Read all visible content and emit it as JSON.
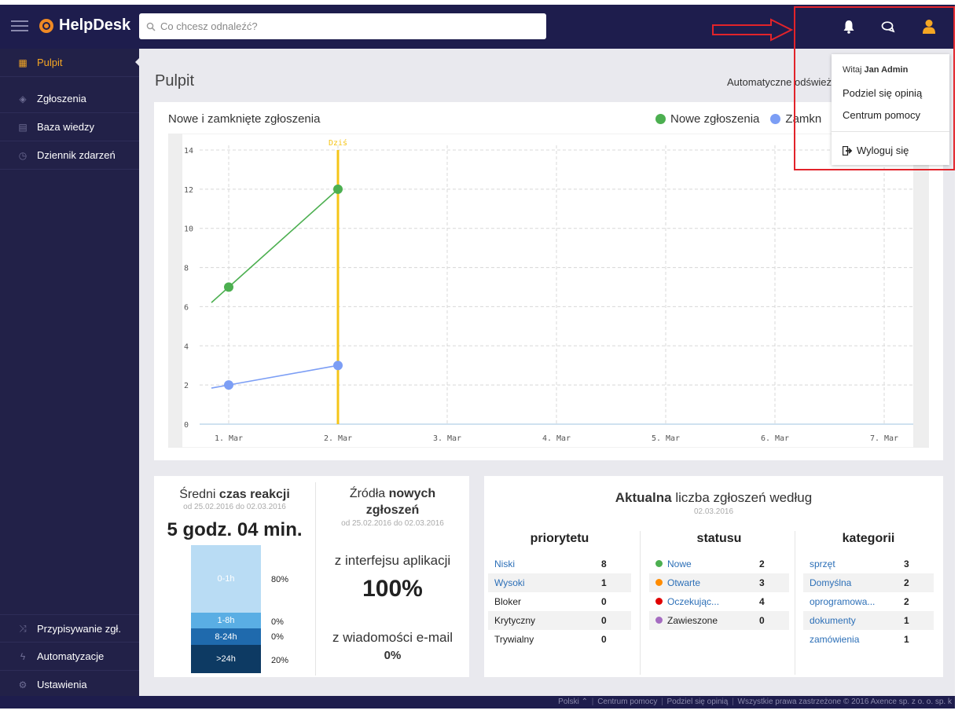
{
  "app": {
    "logo": "HelpDesk"
  },
  "search": {
    "placeholder": "Co chcesz odnaleźć?"
  },
  "sidebar": {
    "items": [
      {
        "label": "Pulpit"
      },
      {
        "label": "Zgłoszenia"
      },
      {
        "label": "Baza wiedzy"
      },
      {
        "label": "Dziennik zdarzeń"
      }
    ],
    "bottom": [
      {
        "label": "Przypisywanie zgł."
      },
      {
        "label": "Automatyzacje"
      },
      {
        "label": "Ustawienia"
      }
    ]
  },
  "page": {
    "title": "Pulpit",
    "auto_refresh": "Automatyczne odśwież"
  },
  "user_menu": {
    "welcome_prefix": "Witaj",
    "user_name": "Jan Admin",
    "items": [
      "Podziel się opinią",
      "Centrum pomocy"
    ],
    "logout": "Wyloguj się"
  },
  "chart_data": {
    "type": "line",
    "title": "Nowe i zamknięte zgłoszenia",
    "x": [
      "1. Mar",
      "2. Mar",
      "3. Mar",
      "4. Mar",
      "5. Mar",
      "6. Mar",
      "7. Mar"
    ],
    "series": [
      {
        "name": "Nowe zgłoszenia",
        "color": "#4caf50",
        "values": [
          7,
          12
        ]
      },
      {
        "name": "Zamkn",
        "color": "#7c9ef5",
        "values": [
          2,
          3
        ]
      }
    ],
    "ylim": [
      0,
      14
    ],
    "yticks": [
      0,
      2,
      4,
      6,
      8,
      10,
      12,
      14
    ],
    "today_label": "Dziś",
    "today_index": 1,
    "today_color": "#f5c518",
    "grid": true,
    "legend": "top-right"
  },
  "response": {
    "title_plain": "Średni",
    "title_bold": "czas reakcji",
    "range": "od 25.02.2016 do 02.03.2016",
    "value": "5 godz. 04 min.",
    "buckets": [
      {
        "label": "0-1h",
        "pct": "80%",
        "share": 0.8,
        "color": "#b9dcf4"
      },
      {
        "label": "1-8h",
        "pct": "0%",
        "share": 0.0,
        "color": "#5aaee4"
      },
      {
        "label": "8-24h",
        "pct": "0%",
        "share": 0.0,
        "color": "#1f6aad"
      },
      {
        "label": ">24h",
        "pct": "20%",
        "share": 0.2,
        "color": "#0d3a63"
      }
    ]
  },
  "sources": {
    "title_plain": "Źródła",
    "title_bold_1": "nowych",
    "title_bold_2": "zgłoszeń",
    "range": "od 25.02.2016 do 02.03.2016",
    "app_label": "z interfejsu aplikacji",
    "app_value": "100%",
    "email_label": "z wiadomości e-mail",
    "email_value": "0%"
  },
  "counts": {
    "title_bold": "Aktualna",
    "title_rest": "liczba zgłoszeń według",
    "date": "02.03.2016",
    "priority": {
      "heading": "priorytetu",
      "rows": [
        {
          "label": "Niski",
          "value": "8",
          "link": true
        },
        {
          "label": "Wysoki",
          "value": "1",
          "link": true
        },
        {
          "label": "Bloker",
          "value": "0",
          "link": false
        },
        {
          "label": "Krytyczny",
          "value": "0",
          "link": false
        },
        {
          "label": "Trywialny",
          "value": "0",
          "link": false
        }
      ]
    },
    "status": {
      "heading": "statusu",
      "rows": [
        {
          "label": "Nowe",
          "value": "2",
          "color": "#4caf50",
          "link": true
        },
        {
          "label": "Otwarte",
          "value": "3",
          "color": "#ff8c00",
          "link": true
        },
        {
          "label": "Oczekując...",
          "value": "4",
          "color": "#e00000",
          "link": true
        },
        {
          "label": "Zawieszone",
          "value": "0",
          "color": "#a56cc1",
          "link": false
        }
      ]
    },
    "category": {
      "heading": "kategorii",
      "rows": [
        {
          "label": "sprzęt",
          "value": "3"
        },
        {
          "label": "Domyślna",
          "value": "2"
        },
        {
          "label": "oprogramowa...",
          "value": "2"
        },
        {
          "label": "dokumenty",
          "value": "1"
        },
        {
          "label": "zamówienia",
          "value": "1"
        }
      ]
    }
  },
  "footer": {
    "language": "Polski",
    "links": [
      "Centrum pomocy",
      "Podziel się opinią",
      "Wszystkie prawa zastrzeżone © 2016 Axence sp. z o. o. sp. k"
    ]
  }
}
